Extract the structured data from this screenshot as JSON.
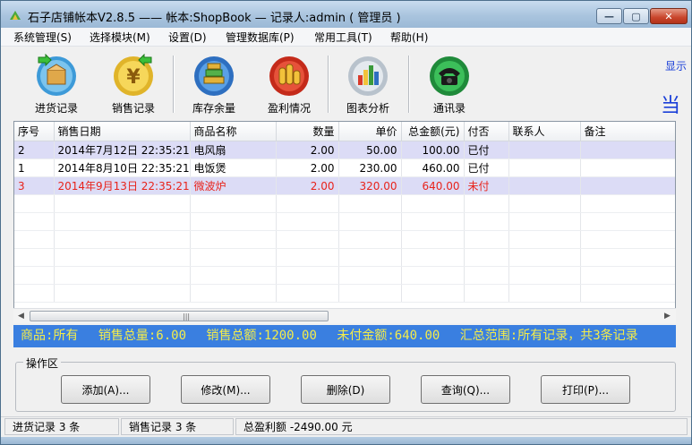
{
  "window": {
    "title": "石子店铺帐本V2.8.5  ——  帐本:ShopBook — 记录人:admin ( 管理员 )",
    "controls": {
      "minimize": "—",
      "maximize": "▢",
      "close": "✕"
    }
  },
  "menu": [
    "系统管理(S)",
    "选择模块(M)",
    "设置(D)",
    "管理数据库(P)",
    "常用工具(T)",
    "帮助(H)"
  ],
  "toolbar": {
    "items": [
      {
        "label": "进货记录",
        "icon": "box-in-icon"
      },
      {
        "label": "销售记录",
        "icon": "yen-coin-icon"
      },
      {
        "label": "库存余量",
        "icon": "stack-icon"
      },
      {
        "label": "盈利情况",
        "icon": "coins-icon"
      },
      {
        "label": "图表分析",
        "icon": "chart-icon"
      },
      {
        "label": "通讯录",
        "icon": "phone-icon"
      }
    ],
    "side_link": "显示",
    "side_big": "当"
  },
  "table": {
    "columns": [
      "序号",
      "销售日期",
      "商品名称",
      "数量",
      "单价",
      "总金额(元)",
      "付否",
      "联系人",
      "备注"
    ],
    "rows": [
      {
        "id": "2",
        "date": "2014年7月12日  22:35:21",
        "product": "电风扇",
        "qty": "2.00",
        "price": "50.00",
        "total": "100.00",
        "paid": "已付",
        "contact": "",
        "note": ""
      },
      {
        "id": "1",
        "date": "2014年8月10日  22:35:21",
        "product": "电饭煲",
        "qty": "2.00",
        "price": "230.00",
        "total": "460.00",
        "paid": "已付",
        "contact": "",
        "note": ""
      },
      {
        "id": "3",
        "date": "2014年9月13日  22:35:21",
        "product": "微波炉",
        "qty": "2.00",
        "price": "320.00",
        "total": "640.00",
        "paid": "未付",
        "contact": "",
        "note": ""
      }
    ]
  },
  "summary": {
    "product": "商品:所有",
    "total_qty": "销售总量:6.00",
    "total_amount": "销售总额:1200.00",
    "unpaid": "未付金额:640.00",
    "range": "汇总范围:所有记录，共3条记录"
  },
  "operations": {
    "legend": "操作区",
    "buttons": [
      "添加(A)...",
      "修改(M)...",
      "删除(D)",
      "查询(Q)...",
      "打印(P)..."
    ]
  },
  "status": {
    "purchase": "进货记录 3 条",
    "sales": "销售记录 3 条",
    "profit": "总盈利额 -2490.00 元"
  },
  "colors": {
    "summary_bg": "#3a7fe0",
    "summary_text": "#f4ec4a",
    "unpaid_row": "#e8231b",
    "row_highlight": "#dcdcf6"
  }
}
